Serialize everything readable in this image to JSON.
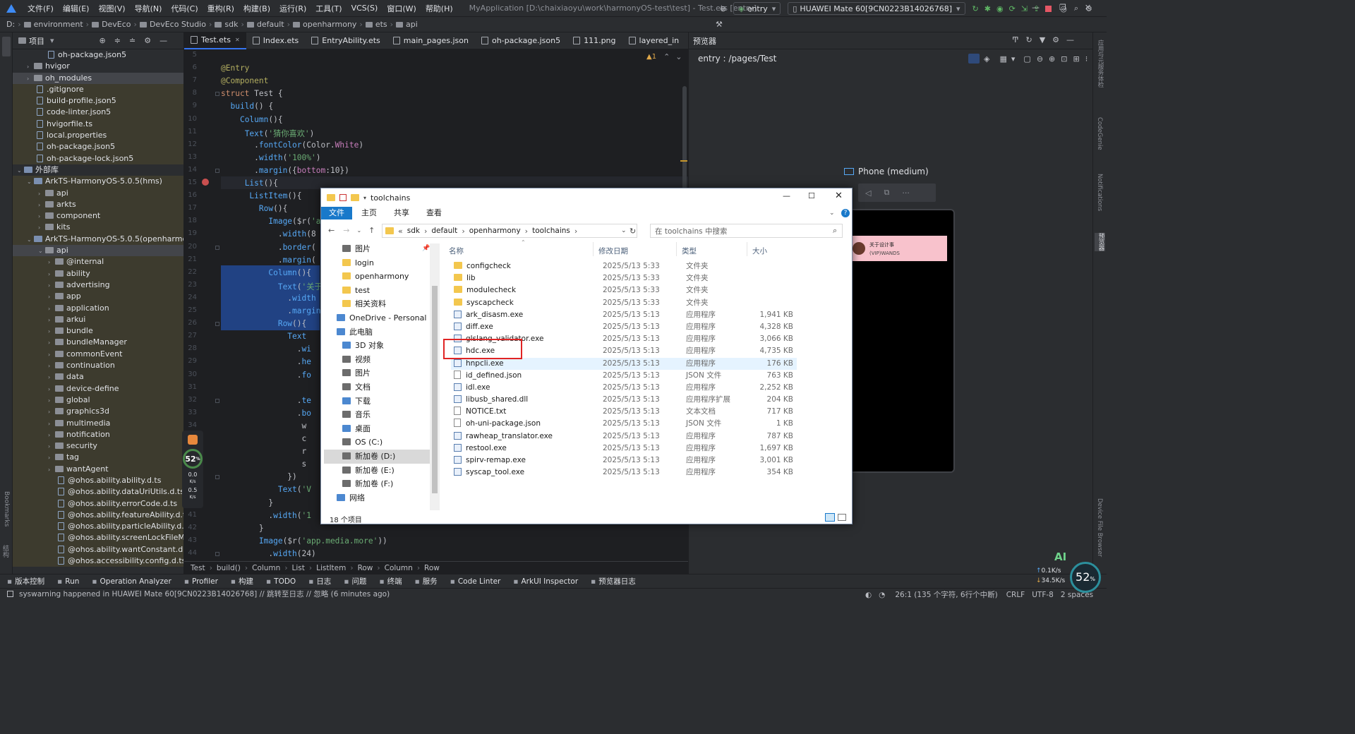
{
  "titlebar": {
    "menus": [
      "文件(F)",
      "编辑(E)",
      "视图(V)",
      "导航(N)",
      "代码(C)",
      "重构(R)",
      "构建(B)",
      "运行(R)",
      "工具(T)",
      "VCS(S)",
      "窗口(W)",
      "帮助(H)"
    ],
    "title": "MyApplication [D:\\chaixiaoyu\\work\\harmonyOS-test\\test] - Test.ets [entry]",
    "run_config": "entry",
    "device": "HUAWEI Mate 60[9CN0223B14026768]"
  },
  "navbar": {
    "crumbs": [
      "D:",
      "environment",
      "DevEco",
      "DevEco Studio",
      "sdk",
      "default",
      "openharmony",
      "ets",
      "api"
    ]
  },
  "project": {
    "title": "项目",
    "items": [
      {
        "label": "oh-package.json5",
        "indent": 50,
        "kind": "file",
        "sel": false
      },
      {
        "label": "hvigor",
        "indent": 20,
        "kind": "folder",
        "arrow": "›",
        "sel": false
      },
      {
        "label": "oh_modules",
        "indent": 20,
        "kind": "folder",
        "arrow": "›",
        "sel": true,
        "ext": true
      },
      {
        "label": ".gitignore",
        "indent": 34,
        "kind": "file",
        "sel": false,
        "ext": true
      },
      {
        "label": "build-profile.json5",
        "indent": 34,
        "kind": "file",
        "sel": false,
        "ext": true
      },
      {
        "label": "code-linter.json5",
        "indent": 34,
        "kind": "file",
        "sel": false,
        "ext": true
      },
      {
        "label": "hvigorfile.ts",
        "indent": 34,
        "kind": "file",
        "sel": false,
        "ext": true
      },
      {
        "label": "local.properties",
        "indent": 34,
        "kind": "file",
        "sel": false,
        "ext": true
      },
      {
        "label": "oh-package.json5",
        "indent": 34,
        "kind": "file",
        "sel": false,
        "ext": true
      },
      {
        "label": "oh-package-lock.json5",
        "indent": 34,
        "kind": "file",
        "sel": false,
        "ext": true
      },
      {
        "label": "外部库",
        "indent": 6,
        "kind": "lib",
        "arrow": "⌄",
        "sel": false
      },
      {
        "label": "ArkTS-HarmonyOS-5.0.5(hms)",
        "indent": 20,
        "kind": "lib",
        "arrow": "⌄",
        "sel": false,
        "ext": true
      },
      {
        "label": "api",
        "indent": 36,
        "kind": "folder",
        "arrow": "›",
        "sel": false,
        "ext": true
      },
      {
        "label": "arkts",
        "indent": 36,
        "kind": "folder",
        "arrow": "›",
        "sel": false,
        "ext": true
      },
      {
        "label": "component",
        "indent": 36,
        "kind": "folder",
        "arrow": "›",
        "sel": false,
        "ext": true
      },
      {
        "label": "kits",
        "indent": 36,
        "kind": "folder",
        "arrow": "›",
        "sel": false,
        "ext": true
      },
      {
        "label": "ArkTS-HarmonyOS-5.0.5(openharmony)",
        "indent": 20,
        "kind": "lib",
        "arrow": "⌄",
        "sel": false,
        "ext": true
      },
      {
        "label": "api",
        "indent": 36,
        "kind": "folder",
        "arrow": "⌄",
        "sel": true
      },
      {
        "label": "@internal",
        "indent": 50,
        "kind": "folder",
        "arrow": "›",
        "sel": false,
        "ext": true
      },
      {
        "label": "ability",
        "indent": 50,
        "kind": "folder",
        "arrow": "›",
        "sel": false,
        "ext": true
      },
      {
        "label": "advertising",
        "indent": 50,
        "kind": "folder",
        "arrow": "›",
        "sel": false,
        "ext": true
      },
      {
        "label": "app",
        "indent": 50,
        "kind": "folder",
        "arrow": "›",
        "sel": false,
        "ext": true
      },
      {
        "label": "application",
        "indent": 50,
        "kind": "folder",
        "arrow": "›",
        "sel": false,
        "ext": true
      },
      {
        "label": "arkui",
        "indent": 50,
        "kind": "folder",
        "arrow": "›",
        "sel": false,
        "ext": true
      },
      {
        "label": "bundle",
        "indent": 50,
        "kind": "folder",
        "arrow": "›",
        "sel": false,
        "ext": true
      },
      {
        "label": "bundleManager",
        "indent": 50,
        "kind": "folder",
        "arrow": "›",
        "sel": false,
        "ext": true
      },
      {
        "label": "commonEvent",
        "indent": 50,
        "kind": "folder",
        "arrow": "›",
        "sel": false,
        "ext": true
      },
      {
        "label": "continuation",
        "indent": 50,
        "kind": "folder",
        "arrow": "›",
        "sel": false,
        "ext": true
      },
      {
        "label": "data",
        "indent": 50,
        "kind": "folder",
        "arrow": "›",
        "sel": false,
        "ext": true
      },
      {
        "label": "device-define",
        "indent": 50,
        "kind": "folder",
        "arrow": "›",
        "sel": false,
        "ext": true
      },
      {
        "label": "global",
        "indent": 50,
        "kind": "folder",
        "arrow": "›",
        "sel": false,
        "ext": true
      },
      {
        "label": "graphics3d",
        "indent": 50,
        "kind": "folder",
        "arrow": "›",
        "sel": false,
        "ext": true
      },
      {
        "label": "multimedia",
        "indent": 50,
        "kind": "folder",
        "arrow": "›",
        "sel": false,
        "ext": true
      },
      {
        "label": "notification",
        "indent": 50,
        "kind": "folder",
        "arrow": "›",
        "sel": false,
        "ext": true
      },
      {
        "label": "security",
        "indent": 50,
        "kind": "folder",
        "arrow": "›",
        "sel": false,
        "ext": true
      },
      {
        "label": "tag",
        "indent": 50,
        "kind": "folder",
        "arrow": "›",
        "sel": false,
        "ext": true
      },
      {
        "label": "wantAgent",
        "indent": 50,
        "kind": "folder",
        "arrow": "›",
        "sel": false,
        "ext": true
      },
      {
        "label": "@ohos.ability.ability.d.ts",
        "indent": 64,
        "kind": "file",
        "sel": false,
        "ext": true
      },
      {
        "label": "@ohos.ability.dataUriUtils.d.ts",
        "indent": 64,
        "kind": "file",
        "sel": false,
        "ext": true
      },
      {
        "label": "@ohos.ability.errorCode.d.ts",
        "indent": 64,
        "kind": "file",
        "sel": false,
        "ext": true
      },
      {
        "label": "@ohos.ability.featureAbility.d.ts",
        "indent": 64,
        "kind": "file",
        "sel": false,
        "ext": true
      },
      {
        "label": "@ohos.ability.particleAbility.d.ts",
        "indent": 64,
        "kind": "file",
        "sel": false,
        "ext": true
      },
      {
        "label": "@ohos.ability.screenLockFileManager.d.ts",
        "indent": 64,
        "kind": "file",
        "sel": false,
        "ext": true
      },
      {
        "label": "@ohos.ability.wantConstant.d.ts",
        "indent": 64,
        "kind": "file",
        "sel": false,
        "ext": true
      },
      {
        "label": "@ohos.accessibility.config.d.ts",
        "indent": 64,
        "kind": "file",
        "sel": false,
        "ext": true
      }
    ]
  },
  "tabs": [
    "Test.ets",
    "Index.ets",
    "EntryAbility.ets",
    "main_pages.json",
    "oh-package.json5",
    "111.png",
    "layered_in"
  ],
  "editor": {
    "warning": "▲1",
    "lines": [
      {
        "n": "5",
        "html": ""
      },
      {
        "n": "6",
        "html": "<span class='an'>@Entry</span>"
      },
      {
        "n": "7",
        "html": "<span class='an'>@Component</span>"
      },
      {
        "n": "8",
        "html": "<span class='kw'>struct</span> <span class='ty'>Test</span> {"
      },
      {
        "n": "9",
        "html": "  <span class='fn'>build</span>() {"
      },
      {
        "n": "10",
        "html": "    <span class='fn'>Column</span>(){"
      },
      {
        "n": "11",
        "html": "     <span class='fn'>Text</span>(<span class='st'>'猜你喜欢'</span>)"
      },
      {
        "n": "12",
        "html": "       .<span class='fn'>fontColor</span>(Color.<span class='pr'>White</span>)"
      },
      {
        "n": "13",
        "html": "       .<span class='fn'>width</span>(<span class='st'>'100%'</span>)"
      },
      {
        "n": "14",
        "html": "       .<span class='fn'>margin</span>({<span class='pr'>bottom</span>:10})"
      },
      {
        "n": "15",
        "html": "     <span class='fn'>List</span>(){"
      },
      {
        "n": "16",
        "html": "      <span class='fn'>ListItem</span>(){"
      },
      {
        "n": "17",
        "html": "        <span class='fn'>Row</span>(){"
      },
      {
        "n": "18",
        "html": "          <span class='fn'>Image</span>($r(<span class='st'>'a</span>"
      },
      {
        "n": "19",
        "html": "            .<span class='fn'>width</span>(8"
      },
      {
        "n": "20",
        "html": "            .<span class='fn'>border</span>("
      },
      {
        "n": "21",
        "html": "            .<span class='fn'>margin</span>("
      },
      {
        "n": "22",
        "html": "          <span class='fn'>Column</span>(){"
      },
      {
        "n": "23",
        "html": "            <span class='fn'>Text</span>(<span class='st'>'关于</span>"
      },
      {
        "n": "24",
        "html": "              .<span class='fn'>width</span>"
      },
      {
        "n": "25",
        "html": "              .<span class='fn'>margin</span>"
      },
      {
        "n": "26",
        "html": "            <span class='fn'>Row</span>(){"
      },
      {
        "n": "27",
        "html": "              <span class='fn'>Text</span>"
      },
      {
        "n": "28",
        "html": "                .<span class='fn'>wi</span>"
      },
      {
        "n": "29",
        "html": "                .<span class='fn'>he</span>"
      },
      {
        "n": "30",
        "html": "                .<span class='fn'>fo</span>"
      },
      {
        "n": "31",
        "html": ""
      },
      {
        "n": "32",
        "html": "                .<span class='fn'>te</span>"
      },
      {
        "n": "33",
        "html": "                .<span class='fn'>bo</span>"
      },
      {
        "n": "34",
        "html": "                 w"
      },
      {
        "n": "35",
        "html": "                 c"
      },
      {
        "n": "36",
        "html": "                 r"
      },
      {
        "n": "37",
        "html": "                 s"
      },
      {
        "n": "38",
        "html": "              })"
      },
      {
        "n": "39",
        "html": "            <span class='fn'>Text</span>(<span class='st'>'V</span>"
      },
      {
        "n": "40",
        "html": "          }"
      },
      {
        "n": "41",
        "html": "          .<span class='fn'>width</span>(<span class='st'>'1</span>"
      },
      {
        "n": "42",
        "html": "        }"
      },
      {
        "n": "43",
        "html": "        <span class='fn'>Image</span>($r(<span class='st'>'app.media.more'</span>))"
      },
      {
        "n": "44",
        "html": "          .<span class='fn'>width</span>(24)"
      }
    ]
  },
  "editor_crumbs": [
    "Test",
    "build()",
    "Column",
    "List",
    "ListItem",
    "Row",
    "Column",
    "Row"
  ],
  "preview": {
    "label": "预览器",
    "route": "entry : /pages/Test",
    "device_label": "Phone (medium)",
    "card_title": "关于设计事",
    "card_sub": "(VIP)WANDS"
  },
  "explorer": {
    "title": "toolchains",
    "ribbon": [
      "文件",
      "主页",
      "共享",
      "查看"
    ],
    "address": [
      "sdk",
      "default",
      "openharmony",
      "toolchains"
    ],
    "search_placeholder": "在 toolchains 中搜索",
    "nav": [
      {
        "label": "图片",
        "icon": "g",
        "indent": 26
      },
      {
        "label": "login",
        "icon": "y",
        "indent": 26
      },
      {
        "label": "openharmony",
        "icon": "y",
        "indent": 26
      },
      {
        "label": "test",
        "icon": "y",
        "indent": 26
      },
      {
        "label": "相关资料",
        "icon": "y",
        "indent": 26
      },
      {
        "label": "OneDrive - Personal",
        "icon": "b",
        "indent": 18
      },
      {
        "label": "此电脑",
        "icon": "b",
        "indent": 18
      },
      {
        "label": "3D 对象",
        "icon": "b",
        "indent": 26
      },
      {
        "label": "视频",
        "icon": "g",
        "indent": 26
      },
      {
        "label": "图片",
        "icon": "g",
        "indent": 26
      },
      {
        "label": "文档",
        "icon": "g",
        "indent": 26
      },
      {
        "label": "下载",
        "icon": "b",
        "indent": 26
      },
      {
        "label": "音乐",
        "icon": "g",
        "indent": 26
      },
      {
        "label": "桌面",
        "icon": "b",
        "indent": 26
      },
      {
        "label": "OS (C:)",
        "icon": "g",
        "indent": 26
      },
      {
        "label": "新加卷 (D:)",
        "icon": "g",
        "indent": 26,
        "sel": true
      },
      {
        "label": "新加卷 (E:)",
        "icon": "g",
        "indent": 26
      },
      {
        "label": "新加卷 (F:)",
        "icon": "g",
        "indent": 26
      },
      {
        "label": "网络",
        "icon": "b",
        "indent": 18
      }
    ],
    "columns": [
      "名称",
      "修改日期",
      "类型",
      "大小"
    ],
    "files": [
      {
        "name": "configcheck",
        "date": "2025/5/13 5:33",
        "type": "文件夹",
        "size": "",
        "kind": "folder"
      },
      {
        "name": "lib",
        "date": "2025/5/13 5:33",
        "type": "文件夹",
        "size": "",
        "kind": "folder"
      },
      {
        "name": "modulecheck",
        "date": "2025/5/13 5:33",
        "type": "文件夹",
        "size": "",
        "kind": "folder"
      },
      {
        "name": "syscapcheck",
        "date": "2025/5/13 5:33",
        "type": "文件夹",
        "size": "",
        "kind": "folder"
      },
      {
        "name": "ark_disasm.exe",
        "date": "2025/5/13 5:13",
        "type": "应用程序",
        "size": "1,941 KB",
        "kind": "exe"
      },
      {
        "name": "diff.exe",
        "date": "2025/5/13 5:13",
        "type": "应用程序",
        "size": "4,328 KB",
        "kind": "exe"
      },
      {
        "name": "glslang_validator.exe",
        "date": "2025/5/13 5:13",
        "type": "应用程序",
        "size": "3,066 KB",
        "kind": "exe"
      },
      {
        "name": "hdc.exe",
        "date": "2025/5/13 5:13",
        "type": "应用程序",
        "size": "4,735 KB",
        "kind": "exe"
      },
      {
        "name": "hnpcli.exe",
        "date": "2025/5/13 5:13",
        "type": "应用程序",
        "size": "176 KB",
        "kind": "exe",
        "hl": true
      },
      {
        "name": "id_defined.json",
        "date": "2025/5/13 5:13",
        "type": "JSON 文件",
        "size": "763 KB",
        "kind": "doc"
      },
      {
        "name": "idl.exe",
        "date": "2025/5/13 5:13",
        "type": "应用程序",
        "size": "2,252 KB",
        "kind": "exe"
      },
      {
        "name": "libusb_shared.dll",
        "date": "2025/5/13 5:13",
        "type": "应用程序扩展",
        "size": "204 KB",
        "kind": "exe"
      },
      {
        "name": "NOTICE.txt",
        "date": "2025/5/13 5:13",
        "type": "文本文档",
        "size": "717 KB",
        "kind": "doc"
      },
      {
        "name": "oh-uni-package.json",
        "date": "2025/5/13 5:13",
        "type": "JSON 文件",
        "size": "1 KB",
        "kind": "doc"
      },
      {
        "name": "rawheap_translator.exe",
        "date": "2025/5/13 5:13",
        "type": "应用程序",
        "size": "787 KB",
        "kind": "exe"
      },
      {
        "name": "restool.exe",
        "date": "2025/5/13 5:13",
        "type": "应用程序",
        "size": "1,697 KB",
        "kind": "exe"
      },
      {
        "name": "spirv-remap.exe",
        "date": "2025/5/13 5:13",
        "type": "应用程序",
        "size": "3,001 KB",
        "kind": "exe"
      },
      {
        "name": "syscap_tool.exe",
        "date": "2025/5/13 5:13",
        "type": "应用程序",
        "size": "354 KB",
        "kind": "exe"
      }
    ],
    "item_count": "18 个项目"
  },
  "toolwin": [
    "版本控制",
    "Run",
    "Operation Analyzer",
    "Profiler",
    "构建",
    "TODO",
    "日志",
    "问题",
    "终端",
    "服务",
    "Code Linter",
    "ArkUI Inspector",
    "预览器日志"
  ],
  "status": {
    "message": "syswarning happened in HUAWEI Mate 60[9CN0223B14026768] // 跳转至日志 // 忽略 (6 minutes ago)",
    "position": "26:1 (135 个字符, 6行个中断)",
    "eol": "CRLF",
    "encoding": "UTF-8",
    "indent": "2 spaces"
  },
  "widgets": {
    "cpu": "52",
    "cpu_unit": "%",
    "up": "0.0",
    "down": "0.5",
    "rate_unit": "K/s",
    "net_up": "0.1K/s",
    "net_down": "34.5K/s",
    "gauge2": "52",
    "ai": "AI"
  }
}
